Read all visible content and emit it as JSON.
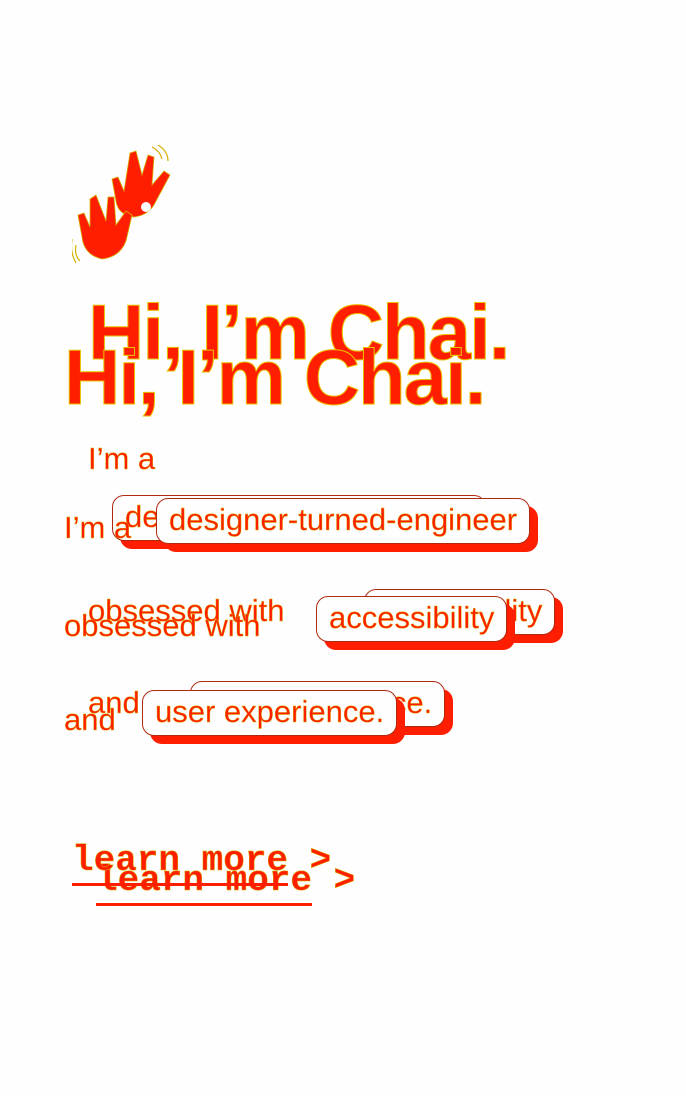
{
  "hero": {
    "headline": "Hi, I’m Chai.",
    "intro_prefix": "I’m a",
    "role_pill": "designer-turned-engineer",
    "obsessed_prefix": "obsessed with",
    "focus_pill": "accessibility",
    "and_prefix": "and",
    "ux_pill": "user experience.",
    "cta_text": "learn more",
    "cta_arrow": ">"
  },
  "icons": {
    "hands": "waving-hands-icon"
  },
  "colors": {
    "primary": "#ff1f00",
    "outline": "#e8c200",
    "background": "#fefefe"
  }
}
